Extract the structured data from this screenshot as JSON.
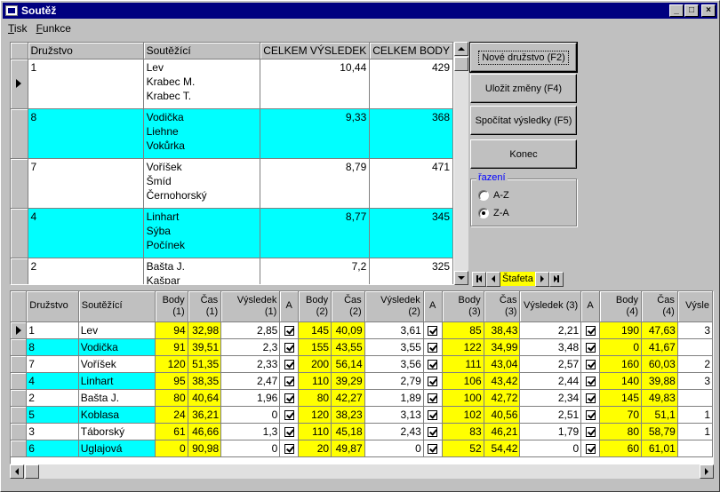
{
  "window": {
    "title": "Soutěž"
  },
  "menu": [
    {
      "accel": "T",
      "rest": "isk"
    },
    {
      "accel": "F",
      "rest": "unkce"
    }
  ],
  "top_grid": {
    "columns": [
      "Družstvo",
      "Soutěžící",
      "CELKEM VÝSLEDEK",
      "CELKEM BODY"
    ],
    "rows": [
      {
        "team": "1",
        "members": [
          "Lev",
          "Krabec M.",
          "Krabec T."
        ],
        "result": "10,44",
        "points": "429",
        "highlight": false,
        "selected": true
      },
      {
        "team": "8",
        "members": [
          "Vodička",
          "Liehne",
          "Vokůrka"
        ],
        "result": "9,33",
        "points": "368",
        "highlight": true,
        "selected": false
      },
      {
        "team": "7",
        "members": [
          "Voříšek",
          "Šmíd",
          "Černohorský"
        ],
        "result": "8,79",
        "points": "471",
        "highlight": false,
        "selected": false
      },
      {
        "team": "4",
        "members": [
          "Linhart",
          "Sýba",
          "Počínek"
        ],
        "result": "8,77",
        "points": "345",
        "highlight": true,
        "selected": false
      },
      {
        "team": "2",
        "members": [
          "Bašta J.",
          "Kašpar"
        ],
        "result": "7,2",
        "points": "325",
        "highlight": false,
        "selected": false
      }
    ]
  },
  "buttons": {
    "new_team": "Nové družstvo (F2)",
    "save": "Uložit změny (F4)",
    "calc": "Spočítat výsledky (F5)",
    "end": "Konec"
  },
  "sort": {
    "legend": "řazení",
    "options": [
      {
        "label": "A-Z",
        "checked": false
      },
      {
        "label": "Z-A",
        "checked": true
      }
    ]
  },
  "navigator": {
    "label": "Štafeta"
  },
  "bottom_grid": {
    "columns": [
      "Družstvo",
      "Soutěžící",
      "Body (1)",
      "Čas (1)",
      "Výsledek (1)",
      "A",
      "Body (2)",
      "Čas (2)",
      "Výsledek (2)",
      "A",
      "Body (3)",
      "Čas (3)",
      "Výsledek (3)",
      "A",
      "Body (4)",
      "Čas (4)",
      "Výsle"
    ],
    "rows": [
      {
        "team": "1",
        "name": "Lev",
        "hl": false,
        "selected": true,
        "v": [
          "94",
          "32,98",
          "2,85",
          true,
          "145",
          "40,09",
          "3,61",
          true,
          "85",
          "38,43",
          "2,21",
          true,
          "190",
          "47,63",
          "3"
        ]
      },
      {
        "team": "8",
        "name": "Vodička",
        "hl": true,
        "selected": false,
        "v": [
          "91",
          "39,51",
          "2,3",
          true,
          "155",
          "43,55",
          "3,55",
          true,
          "122",
          "34,99",
          "3,48",
          true,
          "0",
          "41,67",
          ""
        ]
      },
      {
        "team": "7",
        "name": "Voříšek",
        "hl": false,
        "selected": false,
        "v": [
          "120",
          "51,35",
          "2,33",
          true,
          "200",
          "56,14",
          "3,56",
          true,
          "111",
          "43,04",
          "2,57",
          true,
          "160",
          "60,03",
          "2"
        ]
      },
      {
        "team": "4",
        "name": "Linhart",
        "hl": true,
        "selected": false,
        "v": [
          "95",
          "38,35",
          "2,47",
          true,
          "110",
          "39,29",
          "2,79",
          true,
          "106",
          "43,42",
          "2,44",
          true,
          "140",
          "39,88",
          "3"
        ]
      },
      {
        "team": "2",
        "name": "Bašta J.",
        "hl": false,
        "selected": false,
        "v": [
          "80",
          "40,64",
          "1,96",
          true,
          "80",
          "42,27",
          "1,89",
          true,
          "100",
          "42,72",
          "2,34",
          true,
          "145",
          "49,83",
          ""
        ]
      },
      {
        "team": "5",
        "name": "Koblasa",
        "hl": true,
        "selected": false,
        "v": [
          "24",
          "36,21",
          "0",
          true,
          "120",
          "38,23",
          "3,13",
          true,
          "102",
          "40,56",
          "2,51",
          true,
          "70",
          "51,1",
          "1"
        ]
      },
      {
        "team": "3",
        "name": "Táborský",
        "hl": false,
        "selected": false,
        "v": [
          "61",
          "46,66",
          "1,3",
          true,
          "110",
          "45,18",
          "2,43",
          true,
          "83",
          "46,21",
          "1,79",
          true,
          "80",
          "58,79",
          "1"
        ]
      },
      {
        "team": "6",
        "name": "Uglajová",
        "hl": true,
        "selected": false,
        "v": [
          "0",
          "90,98",
          "0",
          true,
          "20",
          "49,87",
          "0",
          true,
          "52",
          "54,42",
          "0",
          true,
          "60",
          "61,01",
          ""
        ]
      }
    ]
  },
  "colors": {
    "title_bar": "#000080",
    "row_highlight": "#00ffff",
    "points_highlight": "#ffff00",
    "face": "#c0c0c0"
  }
}
